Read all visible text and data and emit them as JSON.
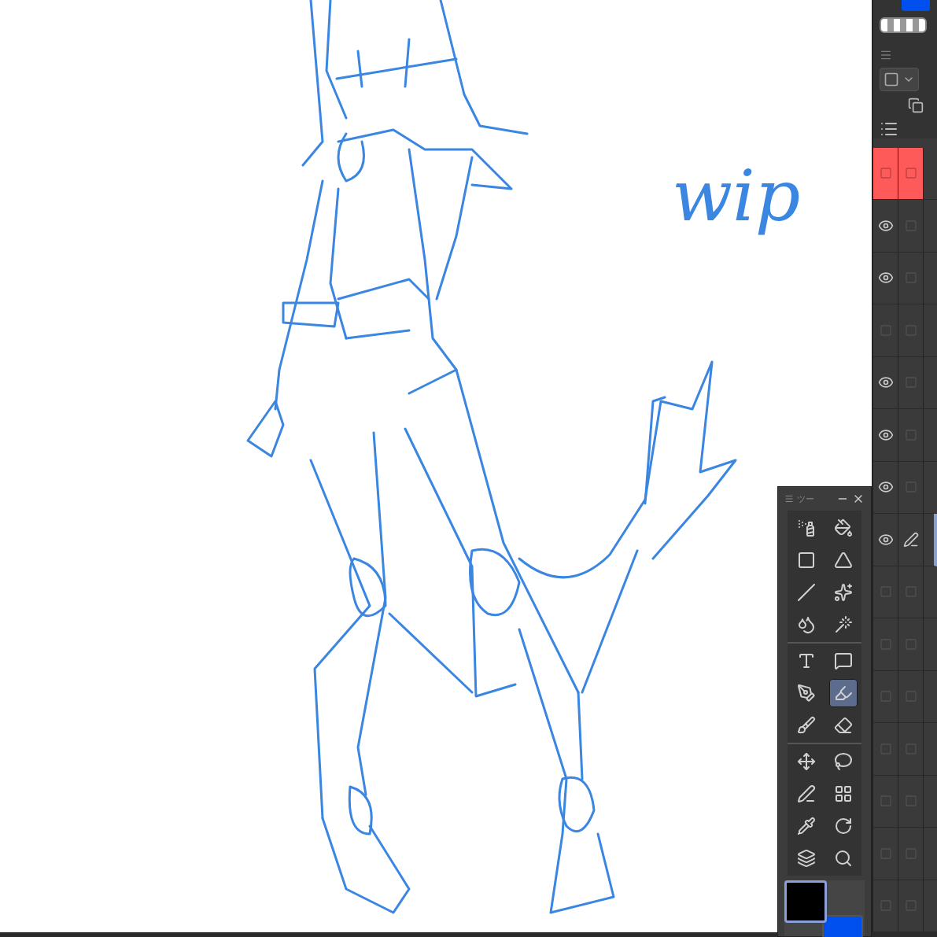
{
  "canvas": {
    "note": "wip"
  },
  "tool_palette": {
    "title": "ツー",
    "tool_groups": [
      [
        {
          "selected": false
        },
        {
          "selected": false
        },
        {
          "selected": false
        },
        {
          "selected": false
        },
        {
          "selected": false
        },
        {
          "selected": false
        },
        {
          "selected": false
        },
        {
          "selected": false
        }
      ],
      [
        {
          "selected": false
        },
        {
          "selected": false
        },
        {
          "selected": false
        },
        {
          "selected": true
        },
        {
          "selected": false
        },
        {
          "selected": false
        }
      ],
      [
        {
          "selected": false
        },
        {
          "selected": false
        },
        {
          "selected": false
        },
        {
          "selected": false
        },
        {
          "selected": false
        },
        {
          "selected": false
        },
        {
          "selected": false
        },
        {
          "selected": false
        }
      ]
    ]
  },
  "layers": [
    {
      "visible": false,
      "flagged": true,
      "selected": false
    },
    {
      "visible": true,
      "flagged": false,
      "selected": false
    },
    {
      "visible": true,
      "flagged": false,
      "selected": false
    },
    {
      "visible": false,
      "flagged": false,
      "selected": false
    },
    {
      "visible": true,
      "flagged": false,
      "selected": false
    },
    {
      "visible": true,
      "flagged": false,
      "selected": false
    },
    {
      "visible": true,
      "flagged": false,
      "selected": false
    },
    {
      "visible": true,
      "flagged": false,
      "selected": true
    },
    {
      "visible": false,
      "flagged": false,
      "selected": false
    },
    {
      "visible": false,
      "flagged": false,
      "selected": false
    },
    {
      "visible": false,
      "flagged": false,
      "selected": false
    },
    {
      "visible": false,
      "flagged": false,
      "selected": false
    },
    {
      "visible": false,
      "flagged": false,
      "selected": false
    },
    {
      "visible": false,
      "flagged": false,
      "selected": false
    },
    {
      "visible": false,
      "flagged": false,
      "selected": false
    }
  ]
}
